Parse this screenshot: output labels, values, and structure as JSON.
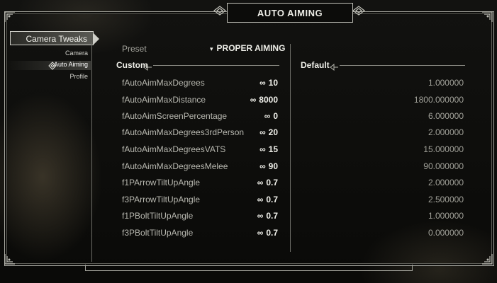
{
  "title": "AUTO AIMING",
  "nav": {
    "main": "Camera Tweaks",
    "items": [
      {
        "label": "Camera",
        "selected": false
      },
      {
        "label": "Auto Aiming",
        "selected": true
      },
      {
        "label": "Profile",
        "selected": false
      }
    ]
  },
  "preset": {
    "label": "Preset",
    "value": "PROPER AIMING"
  },
  "sections": {
    "custom": "Custom",
    "default": "Default"
  },
  "symbols": {
    "infinity": "∞",
    "caret": "▾"
  },
  "rows": [
    {
      "name": "fAutoAimMaxDegrees",
      "value": "10",
      "default": "1.000000"
    },
    {
      "name": "fAutoAimMaxDistance",
      "value": "8000",
      "default": "1800.000000"
    },
    {
      "name": "fAutoAimScreenPercentage",
      "value": "0",
      "default": "6.000000"
    },
    {
      "name": "fAutoAimMaxDegrees3rdPerson",
      "value": "20",
      "default": "2.000000"
    },
    {
      "name": "fAutoAimMaxDegreesVATS",
      "value": "15",
      "default": "15.000000"
    },
    {
      "name": "fAutoAimMaxDegreesMelee",
      "value": "90",
      "default": "90.000000"
    },
    {
      "name": "f1PArrowTiltUpAngle",
      "value": "0.7",
      "default": "2.000000"
    },
    {
      "name": "f3PArrowTiltUpAngle",
      "value": "0.7",
      "default": "2.500000"
    },
    {
      "name": "f1PBoltTiltUpAngle",
      "value": "0.7",
      "default": "1.000000"
    },
    {
      "name": "f3PBoltTiltUpAngle",
      "value": "0.7",
      "default": "0.000000"
    }
  ]
}
